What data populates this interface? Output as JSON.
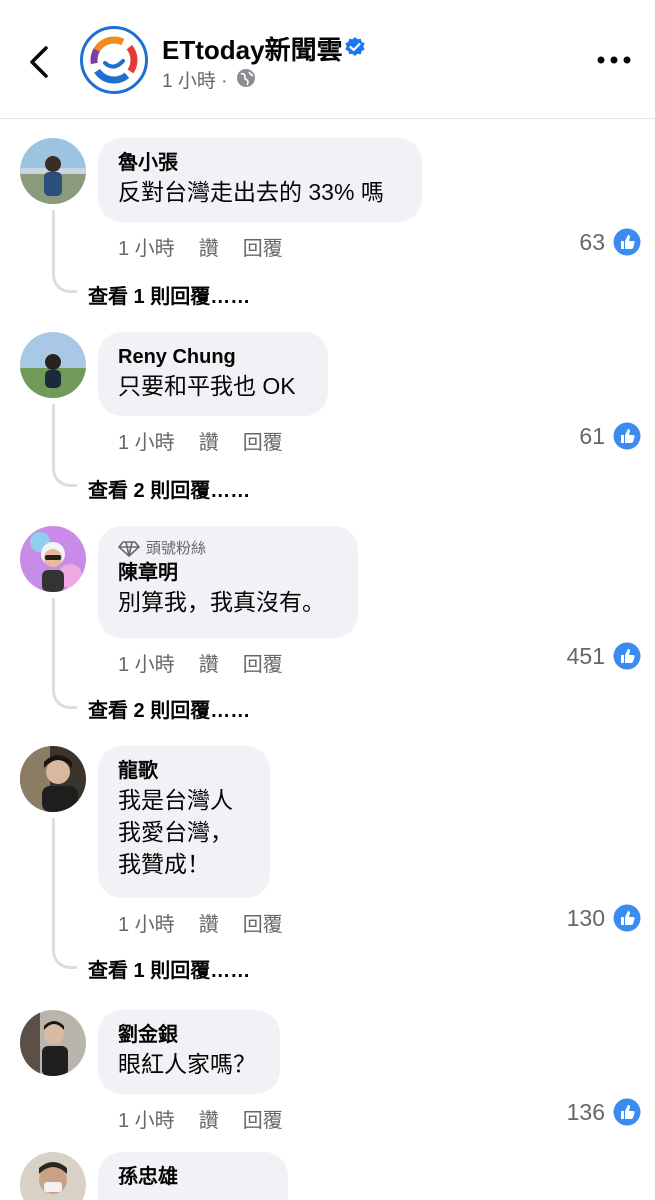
{
  "header": {
    "page_name": "ETtoday新聞雲",
    "post_time": "1 小時 ·",
    "brand_colors": {
      "primary": "#1f6fd1",
      "accent_orange": "#f28b1e",
      "accent_red": "#e53935",
      "accent_purple": "#7b3fa0"
    }
  },
  "comments": [
    {
      "author": "魯小張",
      "text": [
        "反對台灣走出去的 33% 嗎"
      ],
      "time": "1 小時",
      "like_label": "讚",
      "reply_label": "回覆",
      "likes": "63",
      "view_replies": "查看 1 則回覆……"
    },
    {
      "author": "Reny Chung",
      "text": [
        "只要和平我也 OK"
      ],
      "time": "1 小時",
      "like_label": "讚",
      "reply_label": "回覆",
      "likes": "61",
      "view_replies": "查看 2 則回覆……"
    },
    {
      "badge": "頭號粉絲",
      "author": "陳章明",
      "text": [
        "別算我，我真沒有。"
      ],
      "time": "1 小時",
      "like_label": "讚",
      "reply_label": "回覆",
      "likes": "451",
      "view_replies": "查看 2 則回覆……"
    },
    {
      "author": "龍歌",
      "text": [
        "我是台灣人",
        "我愛台灣，",
        "我贊成！"
      ],
      "time": "1 小時",
      "like_label": "讚",
      "reply_label": "回覆",
      "likes": "130",
      "view_replies": "查看 1 則回覆……"
    },
    {
      "author": "劉金銀",
      "text": [
        "眼紅人家嗎？"
      ],
      "time": "1 小時",
      "like_label": "讚",
      "reply_label": "回覆",
      "likes": "136"
    },
    {
      "author": "孫忠雄",
      "text": []
    }
  ],
  "icons": {
    "back": "chevron-left-icon",
    "more": "more-dots-icon",
    "verified": "verified-badge-icon",
    "globe": "globe-icon",
    "like": "thumbs-up-icon",
    "fan": "diamond-icon"
  },
  "like_color": "#3b8bf0"
}
